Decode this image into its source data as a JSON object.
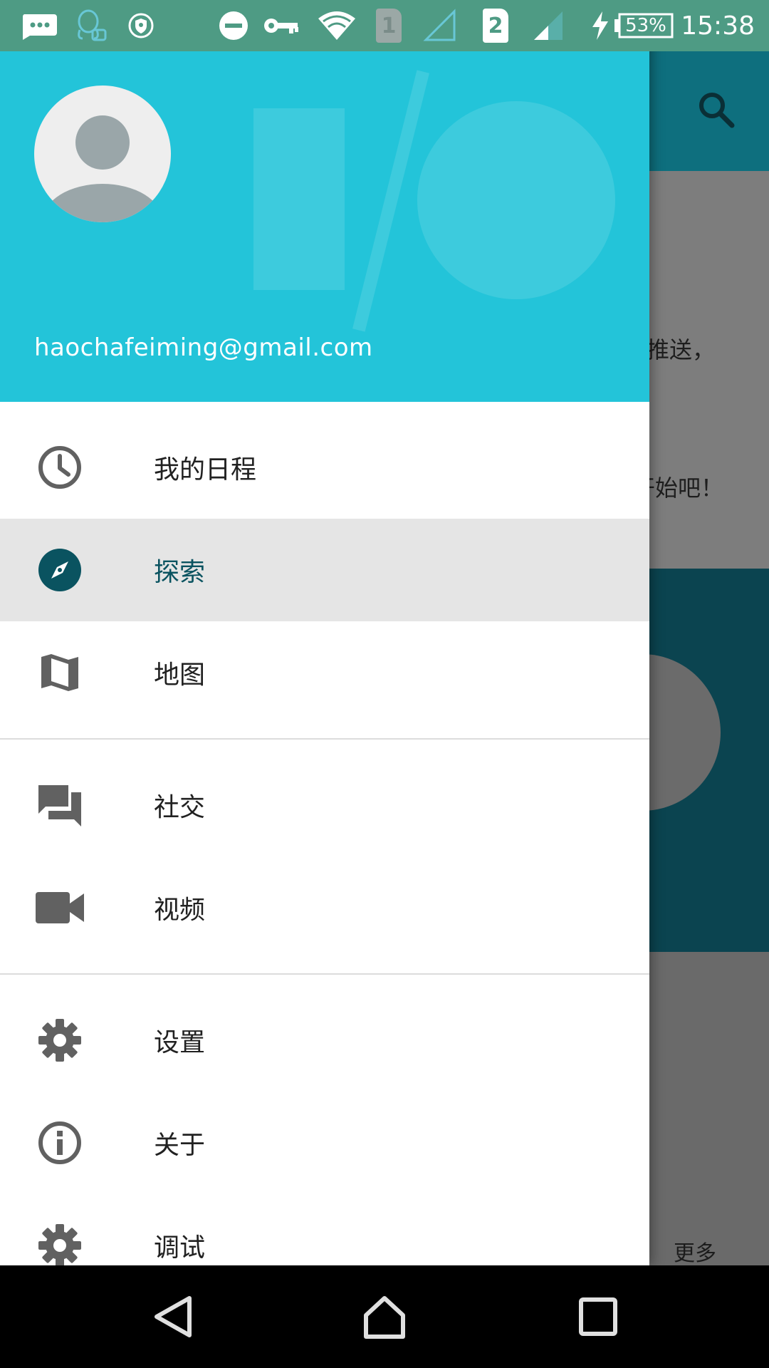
{
  "status_bar": {
    "time": "15:38",
    "battery_percent": "53%",
    "sim1_label": "1",
    "sim2_label": "2",
    "icons": [
      "messages-icon",
      "qq-icon",
      "vpn-shield-icon",
      "do-not-disturb-icon",
      "key-icon",
      "wifi-icon",
      "sim1-icon",
      "signal-empty-icon",
      "sim2-icon",
      "signal-icon",
      "charging-icon",
      "battery-icon"
    ]
  },
  "background_app": {
    "toolbar_icon": "search-icon",
    "card_text_1": "推送，",
    "card_text_2": "开始吧！",
    "more_label": "更多",
    "colors": {
      "toolbar": "#0e6f7e",
      "hero": "#0b4450"
    }
  },
  "drawer": {
    "header": {
      "email": "haochafeiming@gmail.com",
      "avatar_icon": "person-placeholder-icon",
      "background_color": "#23c4d9"
    },
    "groups": [
      {
        "items": [
          {
            "label": "我的日程",
            "icon": "clock-icon",
            "selected": false
          },
          {
            "label": "探索",
            "icon": "compass-icon",
            "selected": true
          },
          {
            "label": "地图",
            "icon": "map-icon",
            "selected": false
          }
        ]
      },
      {
        "items": [
          {
            "label": "社交",
            "icon": "forum-icon",
            "selected": false
          },
          {
            "label": "视频",
            "icon": "videocam-icon",
            "selected": false
          }
        ]
      },
      {
        "items": [
          {
            "label": "设置",
            "icon": "gear-icon",
            "selected": false
          },
          {
            "label": "关于",
            "icon": "info-icon",
            "selected": false
          },
          {
            "label": "调试",
            "icon": "debug-gear-icon",
            "selected": false
          }
        ]
      }
    ],
    "accent_color": "#0a5360"
  },
  "nav_bar": {
    "buttons": [
      "back-icon",
      "home-icon",
      "recents-icon"
    ]
  }
}
